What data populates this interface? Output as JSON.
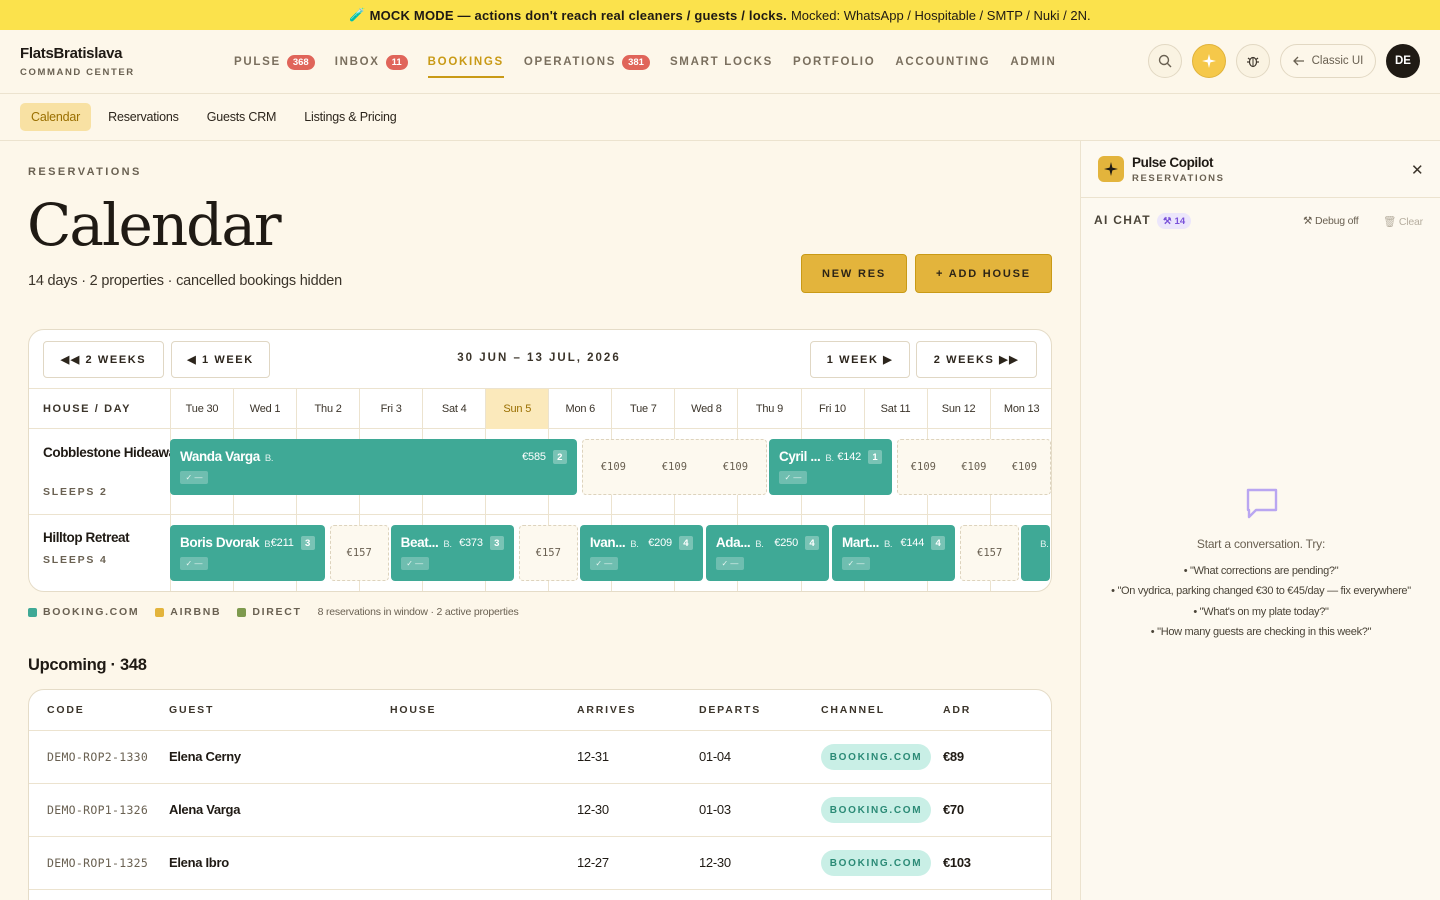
{
  "banner": {
    "icon": "🧪",
    "strong": "MOCK MODE — actions don't reach real cleaners / guests / locks.",
    "rest": "Mocked: WhatsApp / Hospitable / SMTP / Nuki / 2N."
  },
  "brand": {
    "name": "FlatsBratislava",
    "subtitle": "COMMAND CENTER"
  },
  "nav": [
    {
      "label": "PULSE",
      "badge": "368"
    },
    {
      "label": "INBOX",
      "badge": "11"
    },
    {
      "label": "BOOKINGS",
      "badge": null,
      "active": true
    },
    {
      "label": "OPERATIONS",
      "badge": "381"
    },
    {
      "label": "SMART LOCKS",
      "badge": null
    },
    {
      "label": "PORTFOLIO",
      "badge": null
    },
    {
      "label": "ACCOUNTING",
      "badge": null
    },
    {
      "label": "ADMIN",
      "badge": null
    }
  ],
  "header": {
    "classic_label": "Classic UI",
    "avatar_initials": "DE",
    "icons": [
      "search-icon",
      "sparkle-icon",
      "bug-icon",
      "arrow-left-icon"
    ]
  },
  "subnav": [
    "Calendar",
    "Reservations",
    "Guests CRM",
    "Listings & Pricing"
  ],
  "page": {
    "eyebrow": "RESERVATIONS",
    "title": "Calendar",
    "subtitle": "14 days · 2 properties · cancelled bookings hidden",
    "new_res": "NEW RES",
    "add_house": "+ ADD HOUSE"
  },
  "calendar": {
    "prev2": "◀◀ 2 WEEKS",
    "prev1": "◀ 1 WEEK",
    "range": "30 JUN – 13 JUL, 2026",
    "next1": "1 WEEK ▶",
    "next2": "2 WEEKS ▶▶",
    "house_day_label": "HOUSE / DAY",
    "days": [
      "Tue 30",
      "Wed 1",
      "Thu 2",
      "Fri 3",
      "Sat 4",
      "Sun 5",
      "Mon 6",
      "Tue 7",
      "Wed 8",
      "Thu 9",
      "Fri 10",
      "Sat 11",
      "Sun 12",
      "Mon 13"
    ],
    "today_index": 5,
    "houses": [
      {
        "name": "Cobblestone Hideaway",
        "sleeps": "SLEEPS 2"
      },
      {
        "name": "Hilltop Retreat",
        "sleeps": "SLEEPS 4"
      }
    ],
    "bookings": [
      {
        "house": 0,
        "start_day": 0,
        "nights": 6.5,
        "guest": "Wanda Varga",
        "src": "B.",
        "price": "€585",
        "guests": "2",
        "tag": "✓ —"
      },
      {
        "house": 0,
        "start_day": 9.5,
        "nights": 2,
        "guest": "Cyril ...",
        "src": "B.",
        "price": "€142",
        "guests": "1",
        "tag": "✓ —"
      },
      {
        "house": 1,
        "start_day": 0,
        "nights": 2.5,
        "guest": "Boris Dvorak",
        "src": "B.",
        "price": "€211",
        "guests": "3",
        "tag": "✓ —"
      },
      {
        "house": 1,
        "start_day": 3.5,
        "nights": 2,
        "guest": "Beat...",
        "src": "B.",
        "price": "€373",
        "guests": "3",
        "tag": "✓ —"
      },
      {
        "house": 1,
        "start_day": 6.5,
        "nights": 2,
        "guest": "Ivan...",
        "src": "B.",
        "price": "€209",
        "guests": "4",
        "tag": "✓ —"
      },
      {
        "house": 1,
        "start_day": 8.5,
        "nights": 2,
        "guest": "Ada...",
        "src": "B.",
        "price": "€250",
        "guests": "4",
        "tag": "✓ —"
      },
      {
        "house": 1,
        "start_day": 10.5,
        "nights": 2,
        "guest": "Mart...",
        "src": "B.",
        "price": "€144",
        "guests": "4",
        "tag": "✓ —"
      },
      {
        "house": 1,
        "start_day": 13.5,
        "nights": 0.5,
        "guest": "",
        "src": "B.",
        "price": "",
        "guests": "",
        "tag": ""
      }
    ],
    "vacancies": [
      {
        "house": 0,
        "start_day": 6.5,
        "nights": 3,
        "prices": [
          "€109",
          "€109",
          "€109"
        ]
      },
      {
        "house": 0,
        "start_day": 11.5,
        "nights": 2.5,
        "prices": [
          "€109",
          "€109",
          "€109"
        ]
      },
      {
        "house": 1,
        "start_day": 2.5,
        "nights": 1,
        "prices": [
          "€157"
        ]
      },
      {
        "house": 1,
        "start_day": 5.5,
        "nights": 1,
        "prices": [
          "€157"
        ]
      },
      {
        "house": 1,
        "start_day": 12.5,
        "nights": 1,
        "prices": [
          "€157"
        ]
      }
    ]
  },
  "legend": {
    "items": [
      {
        "label": "BOOKING.COM",
        "color": "#3fa996"
      },
      {
        "label": "AIRBNB",
        "color": "#e3b43c"
      },
      {
        "label": "DIRECT",
        "color": "#7e9a4e"
      }
    ],
    "note": "8 reservations in window · 2 active properties"
  },
  "upcoming": {
    "title": "Upcoming · 348",
    "columns": [
      "CODE",
      "GUEST",
      "HOUSE",
      "ARRIVES",
      "DEPARTS",
      "CHANNEL",
      "ADR"
    ],
    "rows": [
      {
        "code": "DEMO-ROP2-1330",
        "guest": "Elena Cerny",
        "house": "",
        "arrives": "12-31",
        "departs": "01-04",
        "channel": "BOOKING.COM",
        "adr": "€89"
      },
      {
        "code": "DEMO-ROP1-1326",
        "guest": "Alena Varga",
        "house": "",
        "arrives": "12-30",
        "departs": "01-03",
        "channel": "BOOKING.COM",
        "adr": "€70"
      },
      {
        "code": "DEMO-ROP1-1325",
        "guest": "Elena Ibro",
        "house": "",
        "arrives": "12-27",
        "departs": "12-30",
        "channel": "BOOKING.COM",
        "adr": "€103"
      }
    ]
  },
  "copilot": {
    "title": "Pulse Copilot",
    "subtitle": "RESERVATIONS",
    "chat_label": "AI CHAT",
    "count": "14",
    "debug": "Debug off",
    "clear": "Clear",
    "start": "Start a conversation. Try:",
    "suggestions": [
      "• \"What corrections are pending?\"",
      "• \"On vydrica, parking changed €30 to €45/day — fix everywhere\"",
      "• \"What's on my plate today?\"",
      "• \"How many guests are checking in this week?\""
    ]
  }
}
